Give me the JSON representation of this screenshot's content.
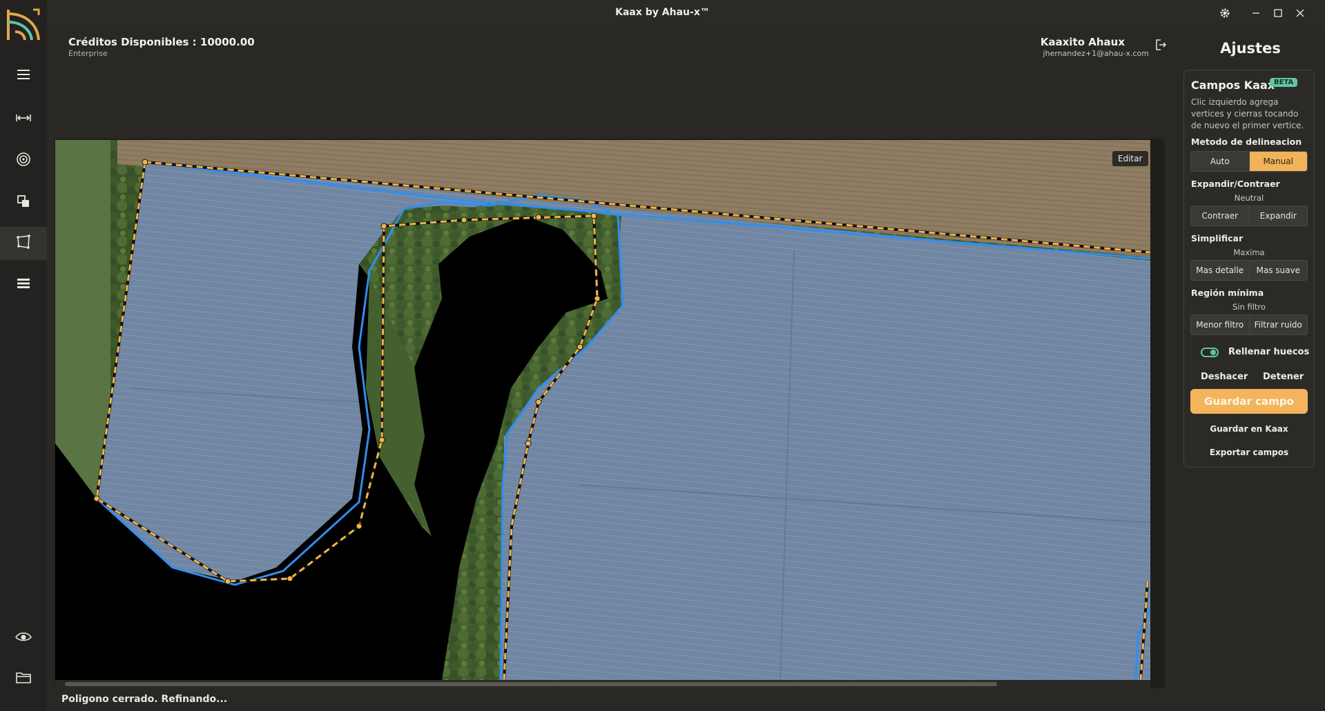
{
  "window": {
    "title": "Kaax by Ahau-x™"
  },
  "header": {
    "credits": "Créditos Disponibles : 10000.00",
    "plan": "Enterprise",
    "user_name": "Kaaxito Ahaux",
    "user_email": "jhernandez+1@ahau-x.com"
  },
  "sidebar": {
    "items": [
      {
        "icon": "menu-icon"
      },
      {
        "icon": "measure-icon"
      },
      {
        "icon": "target-icon"
      },
      {
        "icon": "layers-icon"
      },
      {
        "icon": "polygon-icon",
        "active": true
      },
      {
        "icon": "list-icon"
      }
    ],
    "bottom": [
      {
        "icon": "eye-icon"
      },
      {
        "icon": "folder-icon"
      }
    ]
  },
  "map": {
    "edit_label": "Editar"
  },
  "status": "Poligono cerrado. Refinando...",
  "settings": {
    "title": "Ajustes",
    "panel_title": "Campos Kaax",
    "badge": "BETA",
    "instructions": "Clic izquierdo agrega vertices y cierras tocando de nuevo el primer vertice.",
    "method": {
      "label": "Metodo de delineacion",
      "options": [
        "Auto",
        "Manual"
      ],
      "selected": "Manual"
    },
    "expand": {
      "label": "Expandir/Contraer",
      "value": "Neutral",
      "options": [
        "Contraer",
        "Expandir"
      ]
    },
    "simplify": {
      "label": "Simplificar",
      "value": "Maxima",
      "options": [
        "Mas detalle",
        "Mas suave"
      ]
    },
    "min_region": {
      "label": "Región mínima",
      "value": "Sin filtro",
      "options": [
        "Menor filtro",
        "Filtrar ruido"
      ]
    },
    "fill_holes": {
      "label": "Rellenar huecos",
      "on": true
    },
    "undo": "Deshacer",
    "stop": "Detener",
    "save_field": "Guardar campo",
    "save_kaax": "Guardar en Kaax",
    "export": "Exportar campos"
  },
  "colors": {
    "accent": "#f4b45c",
    "teal": "#5fc6a4",
    "outline_blue": "#2f8ff0",
    "polygon_dash": "#f2b54a"
  }
}
